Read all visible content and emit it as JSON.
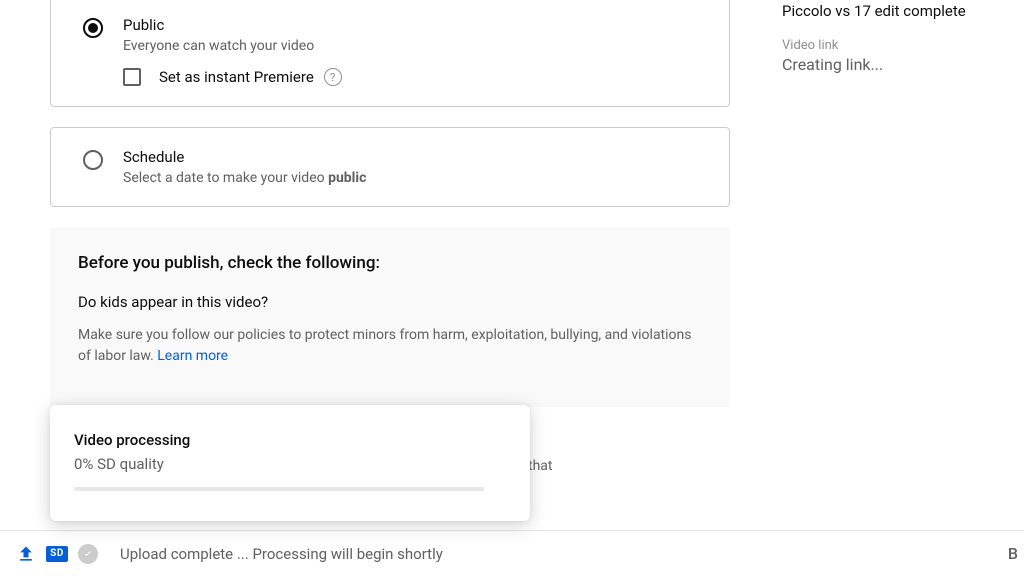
{
  "visibility": {
    "public": {
      "label": "Public",
      "description": "Everyone can watch your video",
      "premiere_label": "Set as instant Premiere"
    },
    "schedule": {
      "label": "Schedule",
      "desc_prefix": "Select a date to make your video ",
      "desc_bold": "public"
    }
  },
  "checks": {
    "heading": "Before you publish, check the following:",
    "kids_q": "Do kids appear in this video?",
    "kids_desc": "Make sure you follow our policies to protect minors from harm, exploitation, bullying, and violations of labor law. ",
    "learn_more": "Learn more",
    "stray_text": "that"
  },
  "processing_popup": {
    "title": "Video processing",
    "status": "0% SD quality"
  },
  "side": {
    "video_title": "Piccolo vs 17 edit complete",
    "link_label": "Video link",
    "link_value": "Creating link..."
  },
  "footer": {
    "sd_label": "SD",
    "status_text": "Upload complete ... Processing will begin shortly",
    "right_char": "B"
  }
}
